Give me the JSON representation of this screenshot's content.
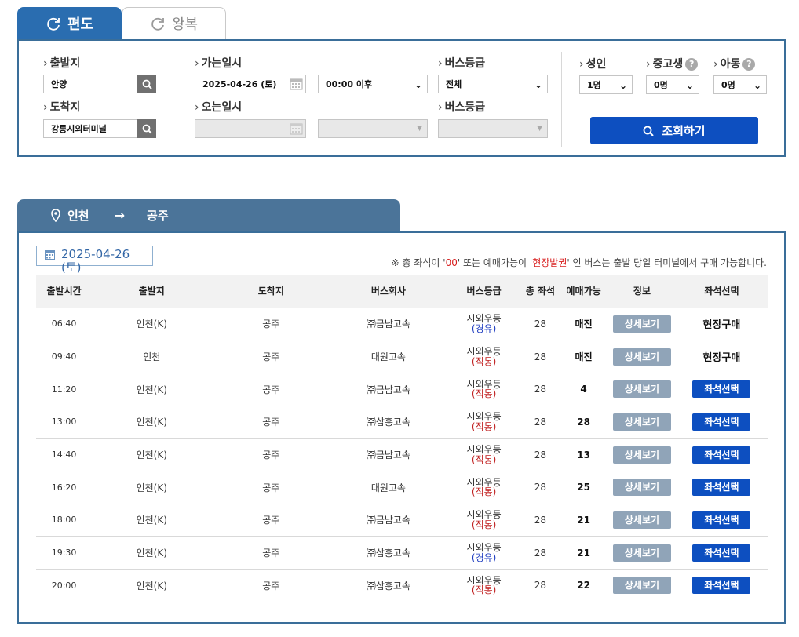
{
  "tabs": {
    "oneway": "편도",
    "roundtrip": "왕복"
  },
  "search": {
    "departure_label": "출발지",
    "departure_value": "안양",
    "arrival_label": "도착지",
    "arrival_value": "강릉시외터미널",
    "go_date_label": "가는일시",
    "go_date_value": "2025-04-26 (토)",
    "go_time_value": "00:00 이후",
    "return_date_label": "오는일시",
    "bus_grade_label": "버스등급",
    "bus_grade_value": "전체",
    "bus_grade_label_2": "버스등급",
    "adult_label": "성인",
    "adult_value": "1명",
    "youth_label": "중고생",
    "youth_value": "0명",
    "child_label": "아동",
    "child_value": "0명",
    "query_button": "조회하기"
  },
  "route": {
    "from": "인천",
    "to": "공주"
  },
  "result": {
    "date": "2025-04-26 (토)",
    "notice_pre": "※ 총 좌석이 '",
    "notice_00": "00",
    "notice_mid": "' 또는 예매가능이 '",
    "notice_onsite": "현장발권",
    "notice_post": "' 인 버스는 출발 당일 터미널에서 구매 가능합니다."
  },
  "table": {
    "headers": [
      "출발시간",
      "출발지",
      "도착지",
      "버스회사",
      "버스등급",
      "총 좌석",
      "예매가능",
      "정보",
      "좌석선택"
    ],
    "rows": [
      {
        "time": "06:40",
        "from": "인천(K)",
        "to": "공주",
        "company": "㈜금남고속",
        "grade": "시외우등",
        "route_type": "(경유)",
        "type_class": "via",
        "seats": "28",
        "available": "매진",
        "info": "상세보기",
        "action": "현장구매",
        "action_type": "onsite"
      },
      {
        "time": "09:40",
        "from": "인천",
        "to": "공주",
        "company": "대원고속",
        "grade": "시외우등",
        "route_type": "(직통)",
        "type_class": "direct",
        "seats": "28",
        "available": "매진",
        "info": "상세보기",
        "action": "현장구매",
        "action_type": "onsite"
      },
      {
        "time": "11:20",
        "from": "인천(K)",
        "to": "공주",
        "company": "㈜금남고속",
        "grade": "시외우등",
        "route_type": "(직통)",
        "type_class": "direct",
        "seats": "28",
        "available": "4",
        "info": "상세보기",
        "action": "좌석선택",
        "action_type": "seat"
      },
      {
        "time": "13:00",
        "from": "인천(K)",
        "to": "공주",
        "company": "㈜삼흥고속",
        "grade": "시외우등",
        "route_type": "(직통)",
        "type_class": "direct",
        "seats": "28",
        "available": "28",
        "info": "상세보기",
        "action": "좌석선택",
        "action_type": "seat"
      },
      {
        "time": "14:40",
        "from": "인천(K)",
        "to": "공주",
        "company": "㈜금남고속",
        "grade": "시외우등",
        "route_type": "(직통)",
        "type_class": "direct",
        "seats": "28",
        "available": "13",
        "info": "상세보기",
        "action": "좌석선택",
        "action_type": "seat"
      },
      {
        "time": "16:20",
        "from": "인천(K)",
        "to": "공주",
        "company": "대원고속",
        "grade": "시외우등",
        "route_type": "(직통)",
        "type_class": "direct",
        "seats": "28",
        "available": "25",
        "info": "상세보기",
        "action": "좌석선택",
        "action_type": "seat"
      },
      {
        "time": "18:00",
        "from": "인천(K)",
        "to": "공주",
        "company": "㈜금남고속",
        "grade": "시외우등",
        "route_type": "(직통)",
        "type_class": "direct",
        "seats": "28",
        "available": "21",
        "info": "상세보기",
        "action": "좌석선택",
        "action_type": "seat"
      },
      {
        "time": "19:30",
        "from": "인천(K)",
        "to": "공주",
        "company": "㈜삼흥고속",
        "grade": "시외우등",
        "route_type": "(경유)",
        "type_class": "via",
        "seats": "28",
        "available": "21",
        "info": "상세보기",
        "action": "좌석선택",
        "action_type": "seat"
      },
      {
        "time": "20:00",
        "from": "인천(K)",
        "to": "공주",
        "company": "㈜삼흥고속",
        "grade": "시외우등",
        "route_type": "(직통)",
        "type_class": "direct",
        "seats": "28",
        "available": "22",
        "info": "상세보기",
        "action": "좌석선택",
        "action_type": "seat"
      }
    ]
  },
  "colors": {
    "primary": "#2a6db0",
    "button_blue": "#0d4fc0",
    "route_header": "#4b7499",
    "border": "#3a6e99",
    "detail_gray": "#90a4b8",
    "direct_red": "#c02020",
    "via_blue": "#1e3cc0"
  }
}
